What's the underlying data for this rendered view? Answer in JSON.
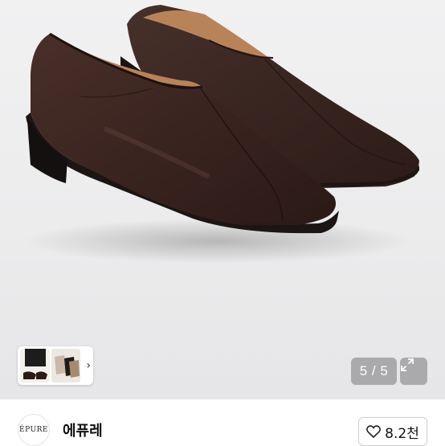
{
  "gallery": {
    "counter": "5 / 5",
    "next_glyph": "›",
    "expand_icon": "expand-icon"
  },
  "shop": {
    "logo_text": "ÉPURE",
    "name": "에퓨레",
    "like_count": "8.2천",
    "like_icon": "heart-outline-icon"
  },
  "colors": {
    "leather": "#3a2420",
    "lining": "#b9835a",
    "sole": "#1c1715",
    "hero_bg": "#ececed"
  }
}
